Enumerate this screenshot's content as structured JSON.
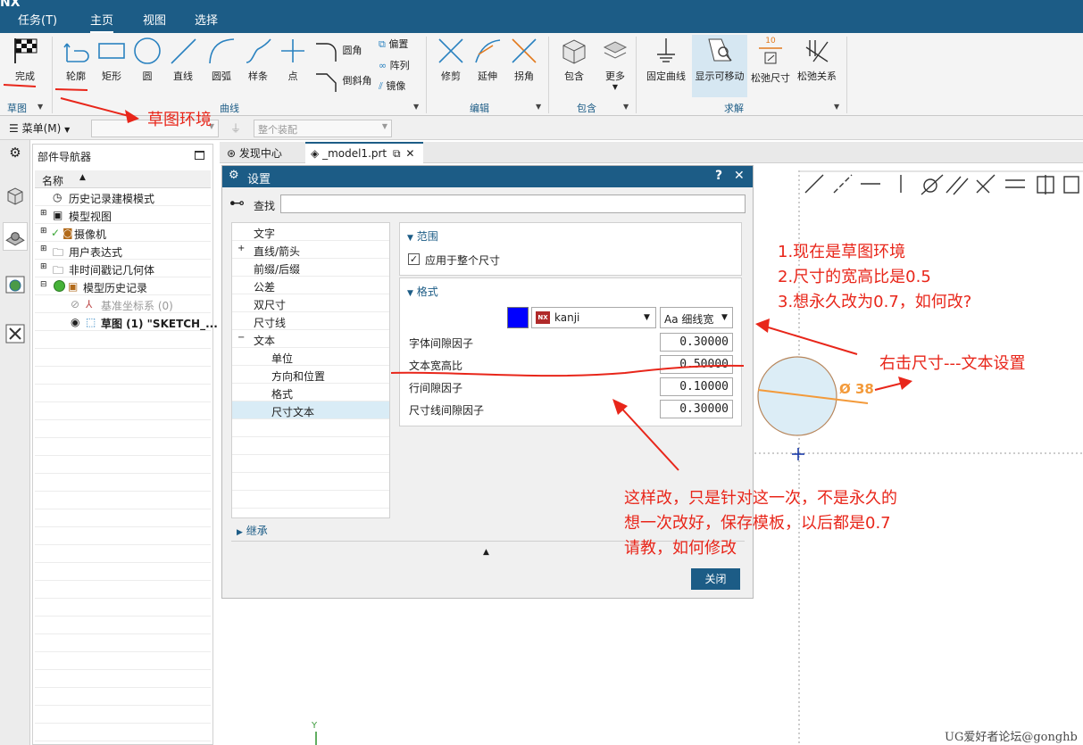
{
  "menubar": {
    "logo": "NX",
    "tabs": [
      {
        "label": "任务(T)"
      },
      {
        "label": "主页"
      },
      {
        "label": "视图"
      },
      {
        "label": "选择"
      }
    ]
  },
  "ribbon": {
    "finish": "完成",
    "sketch_group": "草图",
    "curve": {
      "items": [
        "轮廓",
        "矩形",
        "圆",
        "直线",
        "圆弧",
        "样条",
        "点"
      ],
      "small": [
        "圆角",
        "倒斜角"
      ],
      "small2": [
        "偏置",
        "阵列",
        "镜像"
      ],
      "label": "曲线"
    },
    "edit": {
      "items": [
        "修剪",
        "延伸",
        "拐角"
      ],
      "label": "编辑"
    },
    "include": {
      "items": [
        "包含",
        "更多"
      ],
      "label": "包含"
    },
    "solve": {
      "items": [
        "固定曲线",
        "显示可移动",
        "松弛尺寸",
        "松弛关系"
      ],
      "label": "求解"
    },
    "dim_icon_value": "10"
  },
  "toolbar2": {
    "menu": "菜单(M)",
    "assembly_combo": "整个装配"
  },
  "navigator": {
    "title": "部件导航器",
    "column": "名称",
    "items": [
      {
        "label": "历史记录建模模式"
      },
      {
        "label": "模型视图"
      },
      {
        "label": "摄像机"
      },
      {
        "label": "用户表达式"
      },
      {
        "label": "非时间戳记几何体"
      },
      {
        "label": "模型历史记录"
      },
      {
        "label": "基准坐标系 (0)"
      },
      {
        "label": "草图 (1) \"SKETCH_..."
      }
    ]
  },
  "doc_tabs": [
    {
      "label": "发现中心"
    },
    {
      "label": "_model1.prt"
    }
  ],
  "dialog": {
    "title": "设置",
    "help": "?",
    "close_x": "✕",
    "find_label": "查找",
    "find_value": "",
    "tree": [
      "文字",
      "直线/箭头",
      "前缀/后缀",
      "公差",
      "双尺寸",
      "尺寸线",
      "文本",
      "单位",
      "方向和位置",
      "格式",
      "尺寸文本"
    ],
    "scope": {
      "title": "范围",
      "checkbox": "应用于整个尺寸",
      "checked": true
    },
    "format": {
      "title": "格式",
      "color": "#0000ff",
      "font": "kanji",
      "style": "Aa 细线宽",
      "fields": [
        {
          "label": "字体间隙因子",
          "value": "0.30000"
        },
        {
          "label": "文本宽高比",
          "value": "0.50000"
        },
        {
          "label": "行间隙因子",
          "value": "0.10000"
        },
        {
          "label": "尺寸线间隙因子",
          "value": "0.30000"
        }
      ]
    },
    "inherit": "继承",
    "close_button": "关闭"
  },
  "canvas": {
    "dimension_label": "Ø 38",
    "axis_label": "Y"
  },
  "annotations": {
    "sketch_env": "草图环境",
    "q1": "1.现在是草图环境",
    "q2": "2.尺寸的宽高比是0.5",
    "q3": "3.想永久改为0.7，如何改?",
    "right_click": "右击尺寸---文本设置",
    "note1": "这样改，只是针对这一次，不是永久的",
    "note2": "想一次改好，保存模板，以后都是0.7",
    "note3": "请教，如何修改"
  },
  "watermark": "UG爱好者论坛@gonghb",
  "colors": {
    "accent": "#1c5c86",
    "annotation": "#e8261a"
  }
}
